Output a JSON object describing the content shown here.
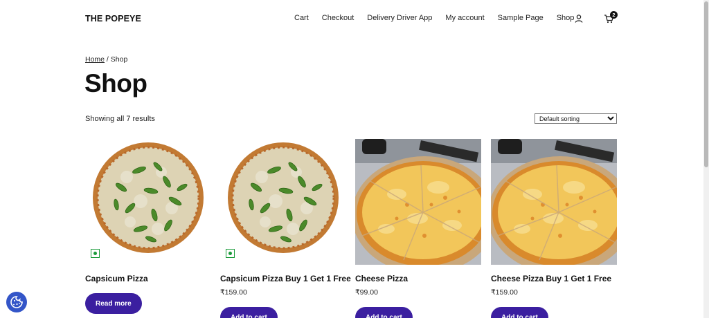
{
  "header": {
    "brand": "THE POPEYE",
    "nav": [
      "Cart",
      "Checkout",
      "Delivery Driver App",
      "My account",
      "Sample Page",
      "Shop"
    ],
    "user_icon": "user-icon",
    "cart_icon": "cart-icon",
    "cart_count": "2"
  },
  "breadcrumb": {
    "home": "Home",
    "separator": " / ",
    "current": "Shop"
  },
  "page_title": "Shop",
  "result_count": "Showing all 7 results",
  "sorting": {
    "selected": "Default sorting"
  },
  "products": [
    {
      "name": "Capsicum Pizza",
      "price": "",
      "button": "Read more",
      "image": "capsicum-pizza",
      "veg": true
    },
    {
      "name": "Capsicum Pizza Buy 1 Get 1 Free",
      "price": "₹159.00",
      "button": "Add to cart",
      "image": "capsicum-pizza",
      "veg": true
    },
    {
      "name": "Cheese Pizza",
      "price": "₹99.00",
      "button": "Add to cart",
      "image": "cheese-pizza",
      "veg": false
    },
    {
      "name": "Cheese Pizza Buy 1 Get 1 Free",
      "price": "₹159.00",
      "button": "Add to cart",
      "image": "cheese-pizza",
      "veg": false
    }
  ],
  "cookie_icon": "cookie-icon",
  "colors": {
    "button": "#3b1fa0",
    "veg_mark": "#1a9a3a",
    "cookie_button": "#3355c8"
  }
}
